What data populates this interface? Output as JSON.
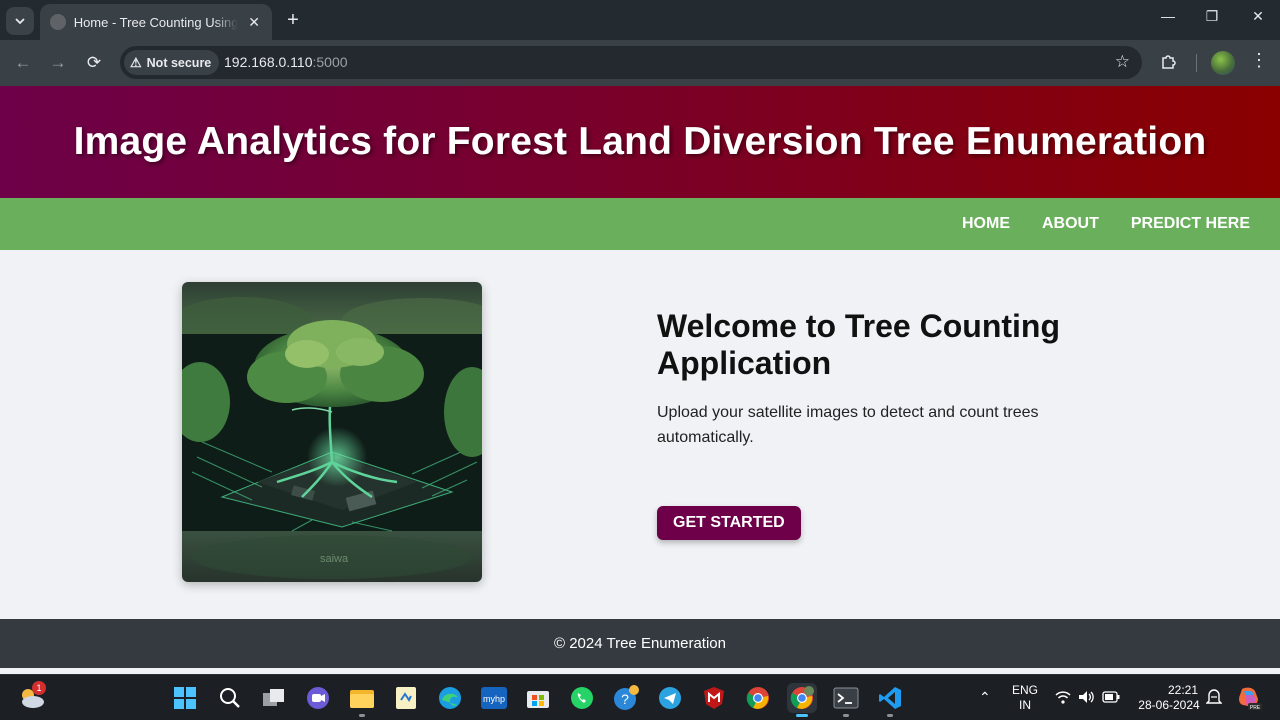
{
  "browser": {
    "tab_title": "Home - Tree Counting Using Satellite Images",
    "url_security": "Not secure",
    "url_host": "192.168.0.110",
    "url_port": ":5000"
  },
  "site": {
    "header_title": "Image Analytics for Forest Land Diversion Tree Enumeration",
    "nav": [
      "HOME",
      "ABOUT",
      "PREDICT HERE"
    ],
    "hero_title": "Welcome to Tree Counting Application",
    "hero_text": "Upload your satellite images to detect and count trees automatically.",
    "cta_label": "GET STARTED",
    "footer": "© 2024 Tree Enumeration",
    "watermark": "saiwa"
  },
  "taskbar": {
    "weather_badge": "1",
    "lang_line1": "ENG",
    "lang_line2": "IN",
    "time": "22:21",
    "date": "28-06-2024",
    "apps": [
      "windows-start",
      "search",
      "task-view",
      "meet",
      "file-explorer",
      "notepad-app",
      "edge",
      "myhp",
      "microsoft-store",
      "whatsapp",
      "help",
      "telegram",
      "mcafee",
      "chrome",
      "chrome-profile",
      "terminal",
      "vscode"
    ]
  },
  "colors": {
    "header_start": "#6d0048",
    "header_end": "#8a0000",
    "nav_bg": "#6ab05c",
    "cta_bg": "#6d0048",
    "footer_bg": "#343a40"
  }
}
